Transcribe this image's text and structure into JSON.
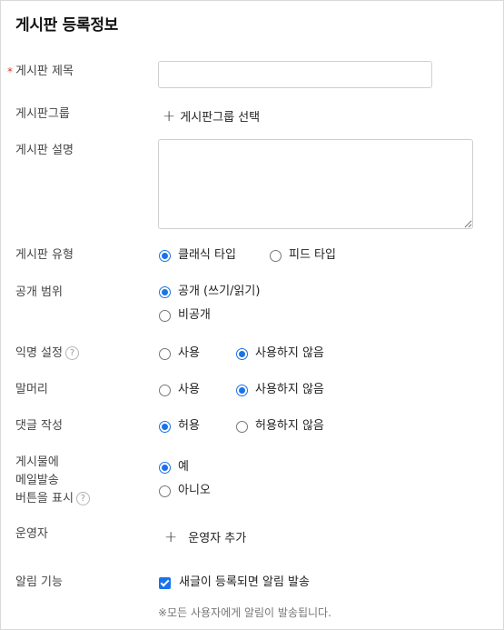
{
  "title": "게시판 등록정보",
  "required_mark": "*",
  "help_glyph": "?",
  "plus_glyph": "+",
  "fields": {
    "board_title": {
      "label": "게시판 제목",
      "value": ""
    },
    "board_group": {
      "label": "게시판그룹",
      "action": "게시판그룹 선택"
    },
    "board_description": {
      "label": "게시판 설명",
      "value": ""
    },
    "board_type": {
      "label": "게시판 유형",
      "options": [
        "클래식 타입",
        "피드 타입"
      ],
      "selected": 0
    },
    "public_scope": {
      "label": "공개 범위",
      "options": [
        "공개 (쓰기/읽기)",
        "비공개"
      ],
      "selected": 0
    },
    "anonymous": {
      "label": "익명 설정",
      "options": [
        "사용",
        "사용하지 않음"
      ],
      "selected": 1
    },
    "prefix": {
      "label": "말머리",
      "options": [
        "사용",
        "사용하지 않음"
      ],
      "selected": 1
    },
    "comment": {
      "label": "댓글 작성",
      "options": [
        "허용",
        "허용하지 않음"
      ],
      "selected": 0
    },
    "mail_button": {
      "label_lines": [
        "게시물에",
        "메일발송",
        "버튼을 표시"
      ],
      "options": [
        "예",
        "아니오"
      ],
      "selected": 0
    },
    "operator": {
      "label": "운영자",
      "action": "운영자 추가"
    },
    "notification": {
      "label": "알림 기능",
      "checkbox_label": "새글이 등록되면 알림 발송",
      "checked": true,
      "note": "※모든 사용자에게 알림이 발송됩니다."
    }
  },
  "colors": {
    "accent": "#1a73e8",
    "required": "#e0352b"
  }
}
